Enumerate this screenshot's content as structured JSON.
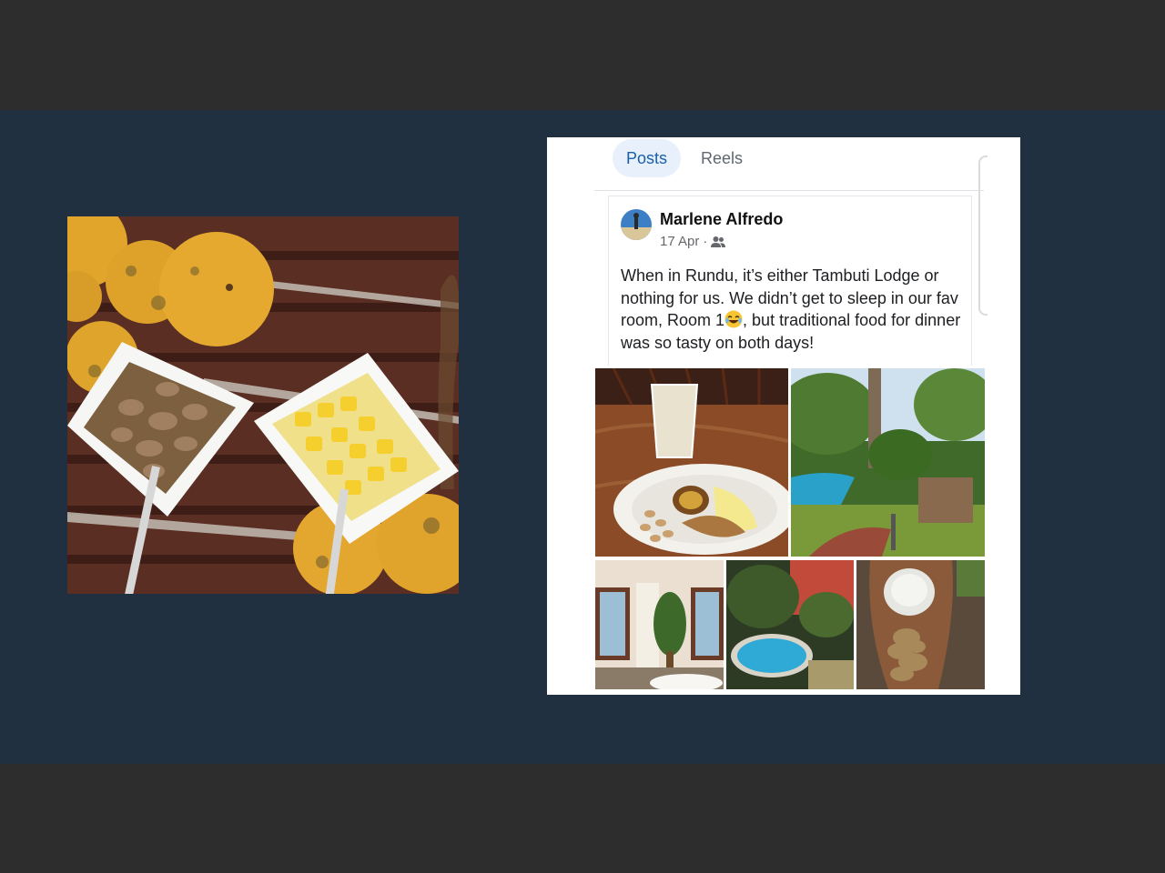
{
  "profile_tabs": [
    {
      "label": "Posts",
      "active": true
    },
    {
      "label": "Reels",
      "active": false
    }
  ],
  "post": {
    "author": "Marlene Alfredo",
    "date": "17 Apr",
    "separator": "·",
    "audience_icon": "friends-icon",
    "text_before_emoji": "When in Rundu, it’s either Tambuti Lodge or nothing for us. We didn’t get to sleep in our fav room, Room 1",
    "emoji": "laughing-tears-emoji",
    "text_after_emoji": ", but traditional food for dinner was so tasty on both days!",
    "photo_count": 5
  },
  "colors": {
    "stage_background": "#213040",
    "frame_background": "#2d2d2e",
    "active_tab_bg": "#e7f0fb",
    "active_tab_text": "#1a5fa8"
  }
}
